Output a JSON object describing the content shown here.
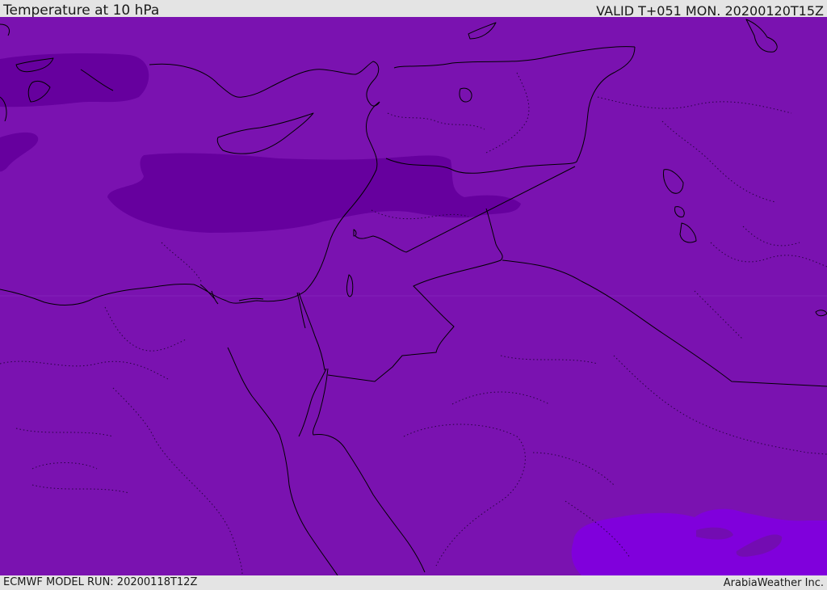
{
  "header": {
    "title": "Temperature at 10 hPa",
    "valid_time": "VALID T+051 MON. 20200120T15Z"
  },
  "footer": {
    "model_run": "ECMWF MODEL RUN: 20200118T12Z",
    "brand": "ArabiaWeather Inc."
  },
  "map": {
    "region": "Eastern Mediterranean and Middle East",
    "colors": {
      "background_field": "#7a12b0",
      "cold_pockets": "#66009e",
      "warm_pocket": "#8000dc",
      "coastline": "#000000"
    }
  }
}
